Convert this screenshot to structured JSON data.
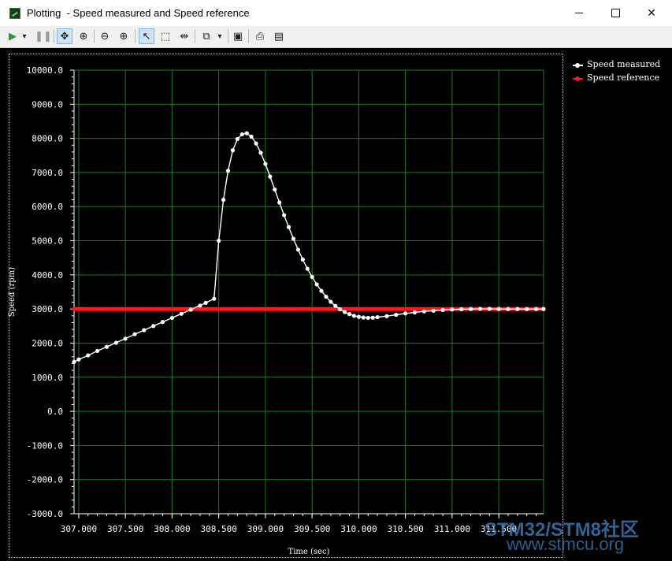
{
  "window": {
    "title": "Plotting  - Speed measured and Speed reference",
    "icon": "plot-app-icon"
  },
  "toolbar": {
    "buttons": [
      {
        "name": "run-icon",
        "glyph": "▶"
      },
      {
        "name": "run-dropdown-icon",
        "glyph": "▾"
      },
      {
        "name": "pause-icon",
        "glyph": "⏸"
      },
      {
        "name": "pan-icon",
        "glyph": "✥"
      },
      {
        "name": "zoom-fit-icon",
        "glyph": "⊕"
      },
      {
        "name": "zoom-out-icon",
        "glyph": "⊖"
      },
      {
        "name": "zoom-in-icon",
        "glyph": "⊕"
      },
      {
        "name": "pointer-icon",
        "glyph": "↖"
      },
      {
        "name": "select-rect-icon",
        "glyph": "⬚"
      },
      {
        "name": "cursor-marker-icon",
        "glyph": "⇹"
      },
      {
        "name": "copy-icon",
        "glyph": "⧉"
      },
      {
        "name": "copy-dropdown-icon",
        "glyph": "▾"
      },
      {
        "name": "save-icon",
        "glyph": "💾"
      },
      {
        "name": "print-icon",
        "glyph": "⎙"
      },
      {
        "name": "print-preview-icon",
        "glyph": "🔍"
      }
    ]
  },
  "colors": {
    "plot_background": "#000000",
    "grid": "#1f7a1f",
    "axis_text": "#ffffff",
    "speed_measured": "#ffffff",
    "speed_reference": "#ff1a1a"
  },
  "chart_data": {
    "type": "line",
    "title": "",
    "xlabel": "Time (sec)",
    "ylabel": "Speed (rpm)",
    "xlim": [
      306.95,
      311.98
    ],
    "ylim": [
      -3000,
      10000
    ],
    "x_ticks": [
      307.0,
      307.5,
      308.0,
      308.5,
      309.0,
      309.5,
      310.0,
      310.5,
      311.0,
      311.5
    ],
    "x_tick_labels": [
      "307.000",
      "307.500",
      "308.000",
      "308.500",
      "309.000",
      "309.500",
      "310.000",
      "310.500",
      "311.000",
      "311.500"
    ],
    "y_ticks": [
      -3000,
      -2000,
      -1000,
      0,
      1000,
      2000,
      3000,
      4000,
      5000,
      6000,
      7000,
      8000,
      9000,
      10000
    ],
    "y_tick_labels": [
      "-3000.0",
      "-2000.0",
      "-1000.0",
      "0.0",
      "1000.0",
      "2000.0",
      "3000.0",
      "4000.0",
      "5000.0",
      "6000.0",
      "7000.0",
      "8000.0",
      "9000.0",
      "10000.0"
    ],
    "grid": true,
    "legend_position": "right",
    "series": [
      {
        "name": "Speed measured",
        "color": "#ffffff",
        "marker": "circle",
        "points": [
          [
            306.95,
            1450
          ],
          [
            307.0,
            1520
          ],
          [
            307.1,
            1640
          ],
          [
            307.2,
            1770
          ],
          [
            307.3,
            1890
          ],
          [
            307.4,
            2010
          ],
          [
            307.5,
            2130
          ],
          [
            307.6,
            2260
          ],
          [
            307.7,
            2380
          ],
          [
            307.8,
            2500
          ],
          [
            307.9,
            2620
          ],
          [
            308.0,
            2740
          ],
          [
            308.1,
            2860
          ],
          [
            308.2,
            2980
          ],
          [
            308.3,
            3100
          ],
          [
            308.36,
            3180
          ],
          [
            308.45,
            3300
          ],
          [
            308.5,
            5000
          ],
          [
            308.55,
            6200
          ],
          [
            308.6,
            7050
          ],
          [
            308.65,
            7650
          ],
          [
            308.7,
            7980
          ],
          [
            308.75,
            8120
          ],
          [
            308.8,
            8150
          ],
          [
            308.85,
            8050
          ],
          [
            308.9,
            7850
          ],
          [
            308.95,
            7580
          ],
          [
            309.0,
            7250
          ],
          [
            309.05,
            6880
          ],
          [
            309.1,
            6500
          ],
          [
            309.15,
            6120
          ],
          [
            309.2,
            5750
          ],
          [
            309.25,
            5400
          ],
          [
            309.3,
            5060
          ],
          [
            309.35,
            4740
          ],
          [
            309.4,
            4450
          ],
          [
            309.45,
            4180
          ],
          [
            309.5,
            3940
          ],
          [
            309.55,
            3720
          ],
          [
            309.6,
            3530
          ],
          [
            309.65,
            3360
          ],
          [
            309.7,
            3210
          ],
          [
            309.75,
            3090
          ],
          [
            309.8,
            2990
          ],
          [
            309.85,
            2910
          ],
          [
            309.9,
            2850
          ],
          [
            309.95,
            2800
          ],
          [
            310.0,
            2770
          ],
          [
            310.05,
            2750
          ],
          [
            310.1,
            2740
          ],
          [
            310.15,
            2745
          ],
          [
            310.2,
            2760
          ],
          [
            310.3,
            2790
          ],
          [
            310.4,
            2830
          ],
          [
            310.5,
            2870
          ],
          [
            310.6,
            2900
          ],
          [
            310.7,
            2930
          ],
          [
            310.8,
            2950
          ],
          [
            310.9,
            2970
          ],
          [
            311.0,
            2985
          ],
          [
            311.1,
            2995
          ],
          [
            311.2,
            3000
          ],
          [
            311.3,
            3005
          ],
          [
            311.4,
            3005
          ],
          [
            311.5,
            3000
          ],
          [
            311.6,
            3000
          ],
          [
            311.7,
            3000
          ],
          [
            311.8,
            2998
          ],
          [
            311.9,
            3000
          ],
          [
            311.98,
            3000
          ]
        ]
      },
      {
        "name": "Speed reference",
        "color": "#ff1a1a",
        "marker": "circle",
        "constant_value": 3000,
        "x_start": 306.95,
        "x_end": 311.98,
        "sample_step": 0.025
      }
    ]
  },
  "watermark": {
    "line1": "STM32/STM8社区",
    "line2": "www.stmcu.org"
  }
}
